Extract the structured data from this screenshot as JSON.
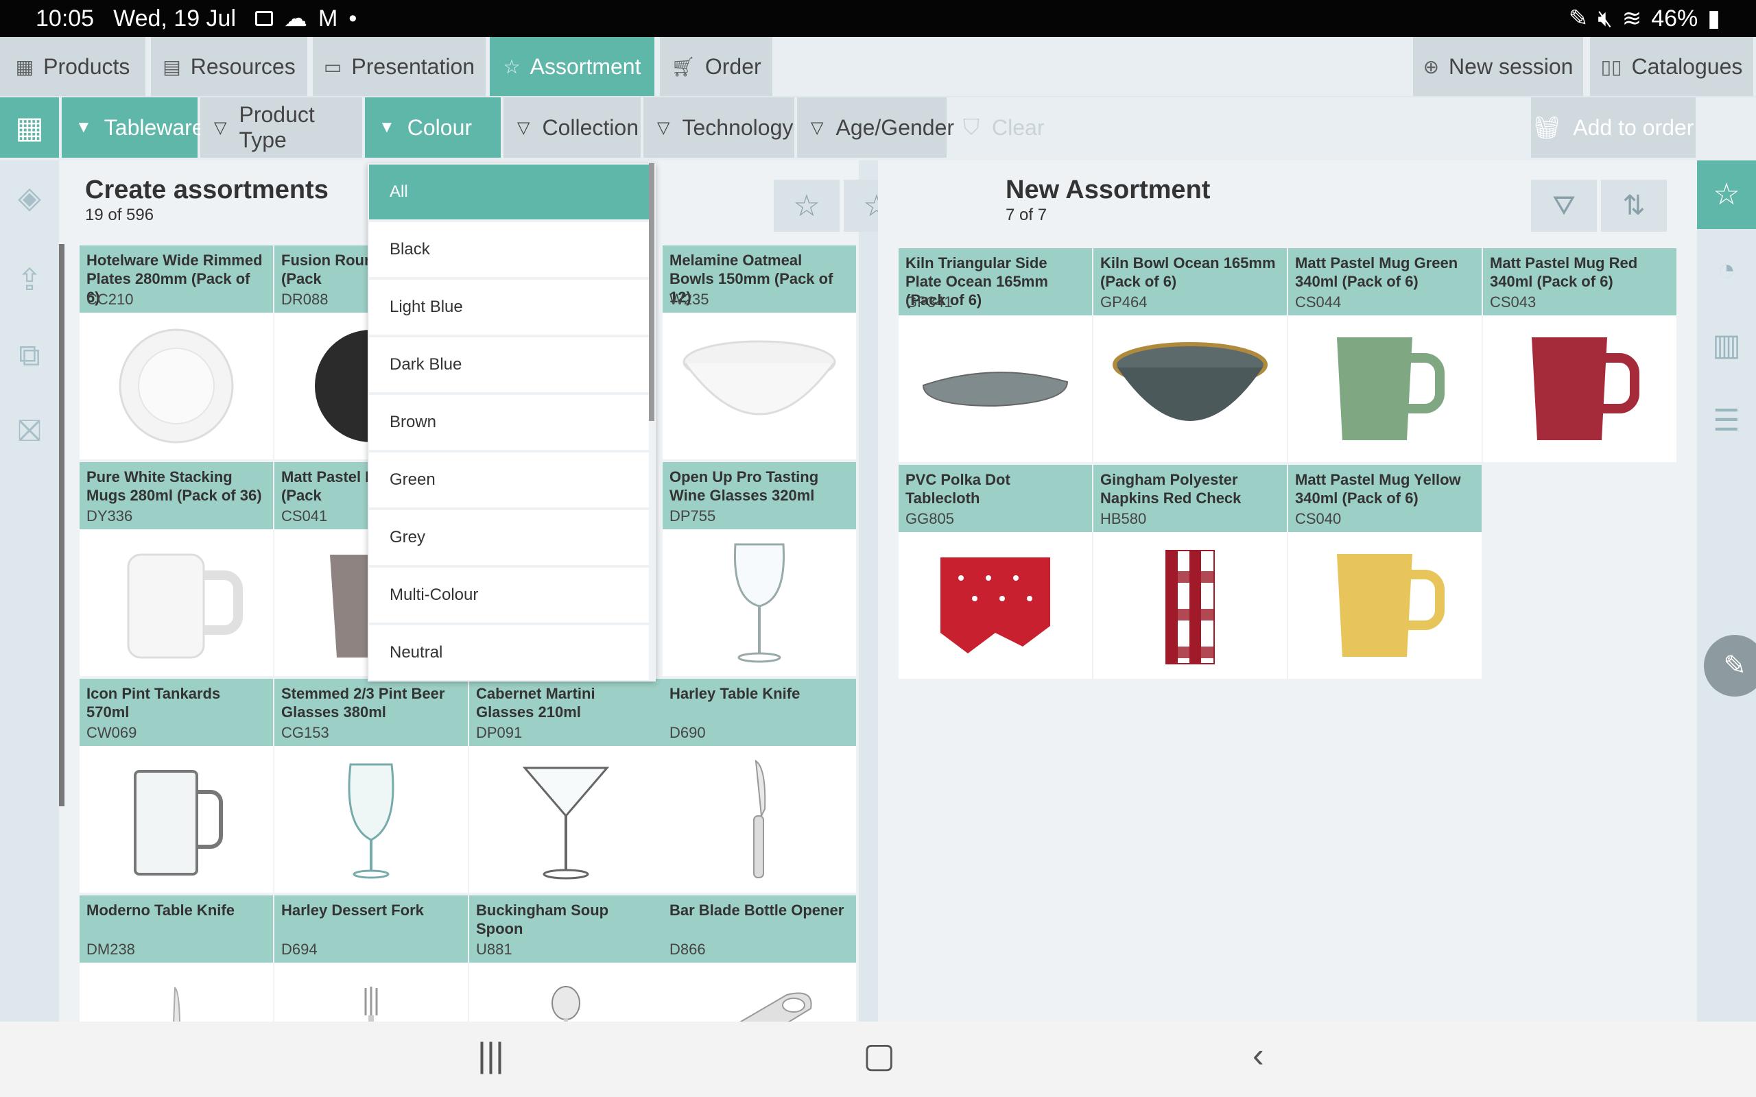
{
  "status": {
    "time": "10:05",
    "date": "Wed, 19 Jul",
    "battery": "46%"
  },
  "tabs": [
    {
      "label": "Products",
      "icon": "grid-icon"
    },
    {
      "label": "Resources",
      "icon": "resources-icon"
    },
    {
      "label": "Presentation",
      "icon": "presentation-icon"
    },
    {
      "label": "Assortment",
      "icon": "star-icon"
    },
    {
      "label": "Order",
      "icon": "cart-icon"
    }
  ],
  "top_right": {
    "new_session": "New session",
    "catalogues": "Catalogues"
  },
  "filters": {
    "tableware": "Tableware",
    "product_type": "Product Type",
    "colour": "Colour",
    "collection": "Collection",
    "technology": "Technology",
    "age_gender": "Age/Gender",
    "clear": "Clear",
    "add_to_order": "Add to order"
  },
  "left": {
    "title": "Create assortments",
    "count": "19 of 596"
  },
  "right": {
    "title": "New Assortment",
    "count": "7 of 7"
  },
  "dropdown": {
    "items": [
      "All",
      "Black",
      "Light Blue",
      "Dark Blue",
      "Brown",
      "Green",
      "Grey",
      "Multi-Colour",
      "Neutral"
    ],
    "selected": "All"
  },
  "left_products": [
    {
      "name": "Hotelware Wide Rimmed Plates 280mm (Pack of 6)",
      "code": "CC210"
    },
    {
      "name": "Fusion Round 270mm (Pack",
      "code": "DR088"
    },
    {
      "name": "",
      "code": ""
    },
    {
      "name": "Melamine Oatmeal Bowls 150mm (Pack of 12)",
      "code": "W235"
    },
    {
      "name": "Pure White Stacking Mugs 280ml (Pack of 36)",
      "code": "DY336"
    },
    {
      "name": "Matt Pastel M 340ml (Pack",
      "code": "CS041"
    },
    {
      "name": "",
      "code": ""
    },
    {
      "name": "Open Up Pro Tasting Wine Glasses 320ml",
      "code": "DP755"
    },
    {
      "name": "Icon Pint Tankards 570ml",
      "code": "CW069"
    },
    {
      "name": "Stemmed 2/3 Pint Beer Glasses 380ml",
      "code": "CG153"
    },
    {
      "name": "Cabernet Martini Glasses 210ml",
      "code": "DP091"
    },
    {
      "name": "Harley Table Knife",
      "code": "D690"
    },
    {
      "name": "Moderno Table Knife",
      "code": "DM238"
    },
    {
      "name": "Harley Dessert Fork",
      "code": "D694"
    },
    {
      "name": "Buckingham Soup Spoon",
      "code": "U881"
    },
    {
      "name": "Bar Blade Bottle Opener",
      "code": "D866"
    }
  ],
  "right_products": [
    {
      "name": "Kiln Triangular Side Plate Ocean 165mm (Pack of 6)",
      "code": "GP341"
    },
    {
      "name": "Kiln Bowl Ocean 165mm (Pack of 6)",
      "code": "GP464"
    },
    {
      "name": "Matt Pastel Mug Green 340ml (Pack of 6)",
      "code": "CS044"
    },
    {
      "name": "Matt Pastel Mug Red 340ml (Pack of 6)",
      "code": "CS043"
    },
    {
      "name": "PVC Polka Dot Tablecloth",
      "code": "GG805"
    },
    {
      "name": "Gingham Polyester Napkins Red Check",
      "code": "HB580"
    },
    {
      "name": "Matt Pastel Mug Yellow 340ml (Pack of 6)",
      "code": "CS040"
    }
  ],
  "colors": {
    "accent": "#5fb7aa",
    "card_header": "#9ccfc6",
    "tab_inactive": "#cfd9de"
  }
}
